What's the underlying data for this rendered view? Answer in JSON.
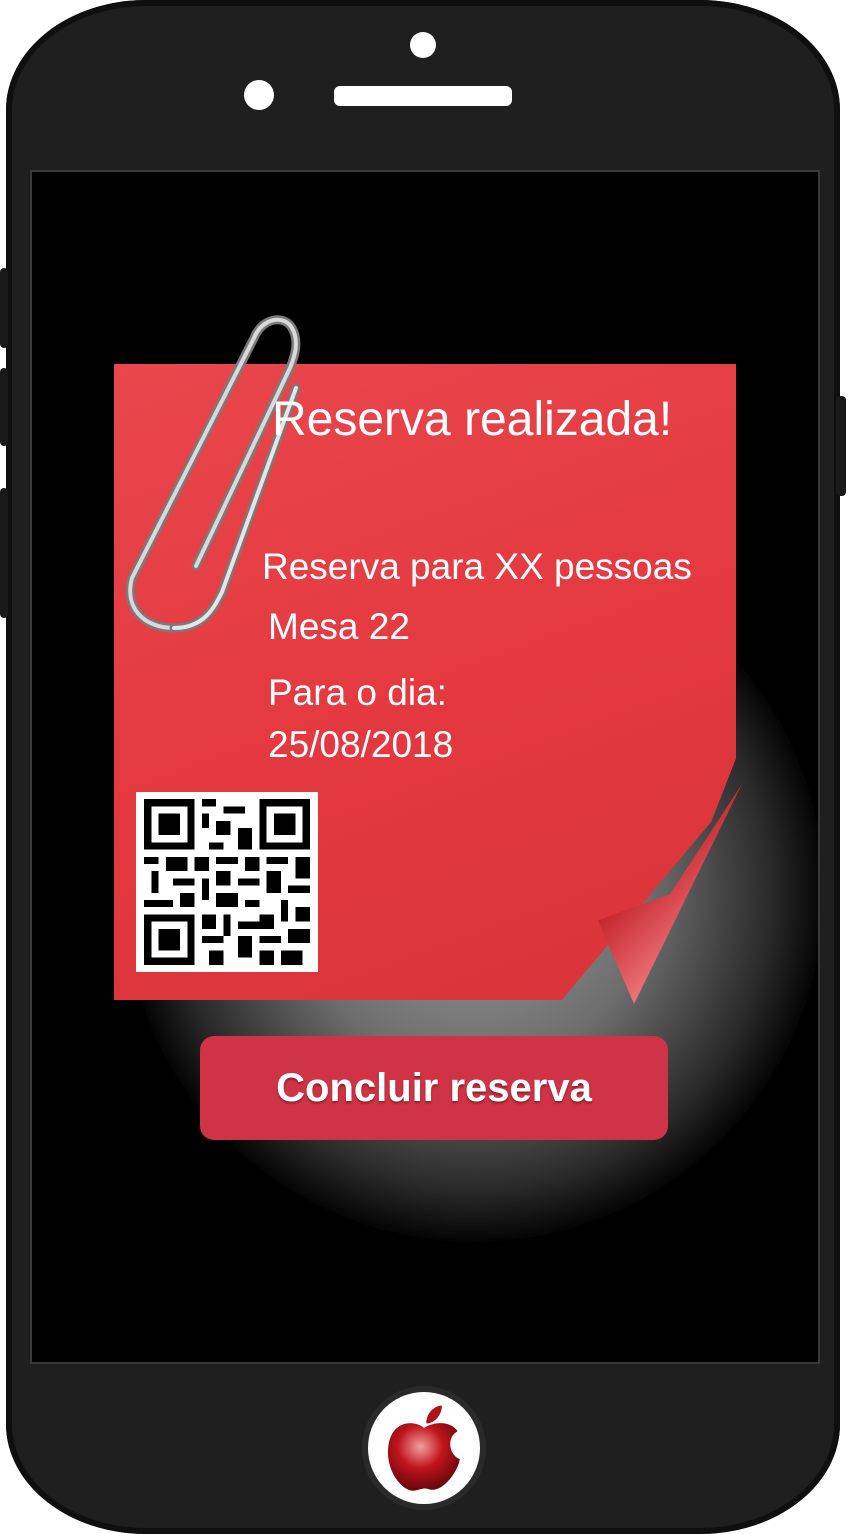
{
  "confirmation": {
    "title": "Reserva realizada!",
    "people_line": "Reserva para XX pessoas",
    "table_line": "Mesa 22",
    "date_label": "Para o dia:",
    "date_value": "25/08/2018"
  },
  "actions": {
    "finish_label": "Concluir reserva"
  },
  "colors": {
    "note_red": "#e3383f",
    "button_red": "#d03345"
  },
  "icons": {
    "paperclip": "paperclip-icon",
    "qr": "qr-code",
    "home": "apple-logo-icon"
  }
}
